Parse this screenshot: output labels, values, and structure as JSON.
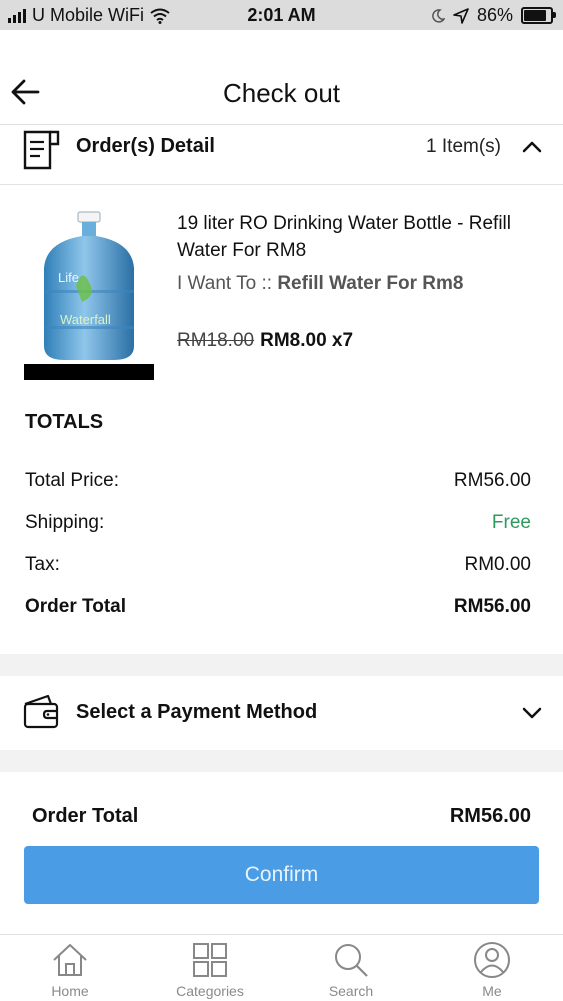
{
  "status_bar": {
    "carrier": "U Mobile WiFi",
    "time": "2:01 AM",
    "battery": "86%"
  },
  "header": {
    "title": "Check out"
  },
  "order_detail": {
    "label": "Order(s) Detail",
    "item_count": "1 Item(s)"
  },
  "product": {
    "name": "19 liter RO Drinking Water Bottle - Refill Water For RM8",
    "variant_prefix": "I Want To :: ",
    "variant_value": "Refill Water For Rm8",
    "price_old": "RM18.00",
    "price_new": "RM8.00 x7",
    "image_text": "Life",
    "image_brand": "Waterfall"
  },
  "totals": {
    "title": "TOTALS",
    "rows": [
      {
        "label": "Total Price:",
        "value": "RM56.00"
      },
      {
        "label": "Shipping:",
        "value": "Free"
      },
      {
        "label": "Tax:",
        "value": "RM0.00"
      },
      {
        "label": "Order Total",
        "value": "RM56.00"
      }
    ]
  },
  "payment": {
    "label": "Select a Payment Method"
  },
  "summary": {
    "label": "Order Total",
    "value": "RM56.00"
  },
  "confirm": {
    "label": "Confirm"
  },
  "tabs": [
    {
      "label": "Home",
      "icon": "home-icon"
    },
    {
      "label": "Categories",
      "icon": "grid-icon"
    },
    {
      "label": "Search",
      "icon": "search-icon"
    },
    {
      "label": "Me",
      "icon": "user-icon"
    }
  ],
  "colors": {
    "accent": "#4a9de4",
    "free": "#2e9a5e"
  }
}
